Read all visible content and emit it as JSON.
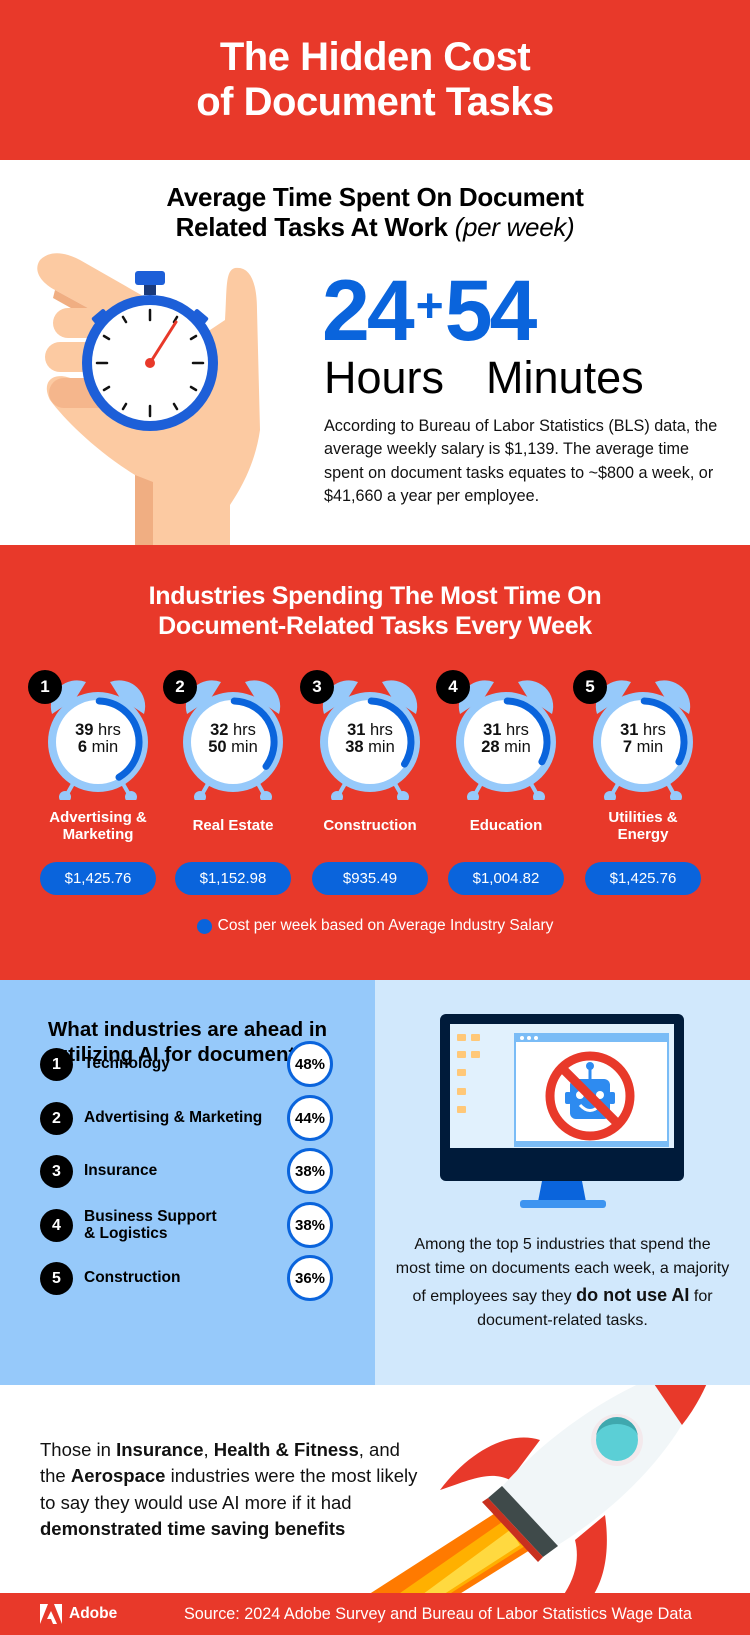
{
  "header": {
    "title_line1": "The Hidden Cost",
    "title_line2": "of Document Tasks"
  },
  "section_time": {
    "subtitle_line1": "Average Time Spent On Document",
    "subtitle_line2": "Related Tasks At Work",
    "subtitle_italic": "(per week)",
    "hours_value": "24",
    "plus": "+",
    "minutes_value": "54",
    "hours_label": "Hours",
    "minutes_label": "Minutes",
    "paragraph": "According to Bureau of Labor Statistics (BLS) data, the average weekly salary is $1,139. The average time spent on document tasks equates to ~$800 a week, or $41,660 a year per employee.",
    "illustration_icon": "hand-holding-stopwatch-icon"
  },
  "section_industries": {
    "title_line1": "Industries Spending The Most Time On",
    "title_line2": "Document-Related Tasks Every Week",
    "items": [
      {
        "rank": "1",
        "hrs": "39 hrs",
        "min": "6 min",
        "industry_line1": "Advertising &",
        "industry_line2": "Marketing",
        "cost": "$1,425.76",
        "progress": 0.39
      },
      {
        "rank": "2",
        "hrs": "32 hrs",
        "min": "50 min",
        "industry_line1": "Real Estate",
        "industry_line2": "",
        "cost": "$1,152.98",
        "progress": 0.33
      },
      {
        "rank": "3",
        "hrs": "31 hrs",
        "min": "38 min",
        "industry_line1": "Construction",
        "industry_line2": "",
        "cost": "$935.49",
        "progress": 0.32
      },
      {
        "rank": "4",
        "hrs": "31 hrs",
        "min": "28 min",
        "industry_line1": "Education",
        "industry_line2": "",
        "cost": "$1,004.82",
        "progress": 0.31
      },
      {
        "rank": "5",
        "hrs": "31 hrs",
        "min": "7 min",
        "industry_line1": "Utilities &",
        "industry_line2": "Energy",
        "cost": "$1,425.76",
        "progress": 0.31
      }
    ],
    "legend": "Cost per week based on Average Industry Salary"
  },
  "section_ai": {
    "title_line1": "What industries are ahead in",
    "title_line2": "utilizing AI for documents?",
    "items": [
      {
        "rank": "1",
        "line1": "Technology",
        "line2": "",
        "pct": "48%"
      },
      {
        "rank": "2",
        "line1": "Advertising & Marketing",
        "line2": "",
        "pct": "44%"
      },
      {
        "rank": "3",
        "line1": "Insurance",
        "line2": "",
        "pct": "38%"
      },
      {
        "rank": "4",
        "line1": "Business Support",
        "line2": "& Logistics",
        "pct": "38%"
      },
      {
        "rank": "5",
        "line1": "Construction",
        "line2": "",
        "pct": "36%"
      }
    ],
    "right_para_before": "Among the top 5 industries that spend the most time on documents each week, a majority of employees say they ",
    "right_para_bold": "do not use AI",
    "right_para_after": " for document-related tasks.",
    "illustration_icon": "monitor-no-robot-icon"
  },
  "section_rocket": {
    "p1": "Those in ",
    "b1": "Insurance",
    "p2": ", ",
    "b2": "Health & Fitness",
    "p3": ", and the ",
    "b3": "Aerospace",
    "p4": " industries were the most likely to say they would use AI more if it had ",
    "b4": "demonstrated time saving benefits",
    "illustration_icon": "rocket-icon"
  },
  "footer": {
    "brand": "Adobe",
    "source": "Source: 2024 Adobe Survey and Bureau of Labor Statistics Wage Data"
  },
  "colors": {
    "red": "#E8392A",
    "blue": "#0A64DC",
    "light_blue": "#96C9FA",
    "pale_blue": "#D1E8FC"
  }
}
